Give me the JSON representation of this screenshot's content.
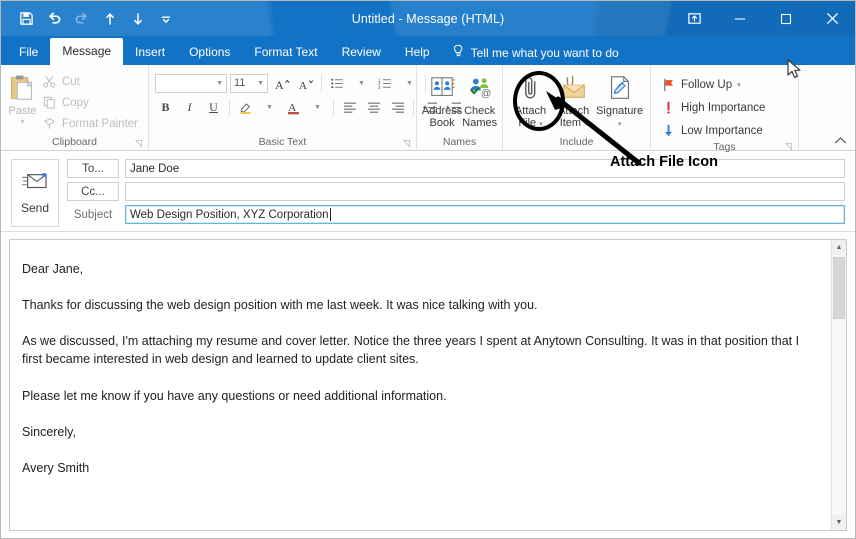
{
  "window": {
    "title": "Untitled  -  Message (HTML)",
    "quick_access": [
      {
        "name": "save",
        "label": "Save",
        "enabled": true
      },
      {
        "name": "undo",
        "label": "Undo",
        "enabled": true
      },
      {
        "name": "redo",
        "label": "Redo",
        "enabled": false
      },
      {
        "name": "previous-item",
        "label": "Previous Item",
        "enabled": true
      },
      {
        "name": "next-item",
        "label": "Next Item",
        "enabled": true
      },
      {
        "name": "customize-quick-access-toolbar",
        "label": "Customize Quick Access Toolbar",
        "enabled": true
      }
    ],
    "controls": [
      {
        "name": "ribbon-display-options",
        "label": "Ribbon Display Options"
      },
      {
        "name": "minimize",
        "label": "Minimize"
      },
      {
        "name": "maximize",
        "label": "Maximize"
      },
      {
        "name": "close",
        "label": "Close"
      }
    ]
  },
  "tabs": [
    {
      "label": "File",
      "active": false
    },
    {
      "label": "Message",
      "active": true
    },
    {
      "label": "Insert",
      "active": false
    },
    {
      "label": "Options",
      "active": false
    },
    {
      "label": "Format Text",
      "active": false
    },
    {
      "label": "Review",
      "active": false
    },
    {
      "label": "Help",
      "active": false
    }
  ],
  "tell_me": {
    "label": "Tell me what you want to do",
    "icon": "lightbulb-icon"
  },
  "ribbon": {
    "clipboard": {
      "group_label": "Clipboard",
      "paste": {
        "label": "Paste",
        "enabled": false
      },
      "items": [
        {
          "label": "Cut",
          "icon": "scissors-icon",
          "enabled": false
        },
        {
          "label": "Copy",
          "icon": "copy-icon",
          "enabled": false
        },
        {
          "label": "Format Painter",
          "icon": "format-painter-icon",
          "enabled": false
        }
      ]
    },
    "basic_text": {
      "group_label": "Basic Text",
      "font_name": "",
      "font_name_placeholder": "",
      "font_size": "11",
      "buttons_row1": [
        {
          "name": "grow-font",
          "label": "A"
        },
        {
          "name": "shrink-font",
          "label": "A"
        },
        {
          "name": "bullets",
          "label": "Bullets"
        },
        {
          "name": "numbering",
          "label": "Numbering"
        },
        {
          "name": "clear-formatting",
          "label": "Clear All Formatting"
        }
      ],
      "buttons_row2": [
        {
          "name": "bold",
          "label": "B"
        },
        {
          "name": "italic",
          "label": "I"
        },
        {
          "name": "underline",
          "label": "U"
        },
        {
          "name": "text-highlight-color",
          "label": "Text Highlight Color"
        },
        {
          "name": "font-color",
          "label": "A"
        },
        {
          "name": "align-left",
          "label": "Align Left"
        },
        {
          "name": "align-center",
          "label": "Center"
        },
        {
          "name": "align-right",
          "label": "Align Right"
        },
        {
          "name": "decrease-indent",
          "label": "Decrease Indent"
        },
        {
          "name": "increase-indent",
          "label": "Increase Indent"
        }
      ]
    },
    "names": {
      "group_label": "Names",
      "items": [
        {
          "label_line1": "Address",
          "label_line2": "Book",
          "icon": "address-book-icon"
        },
        {
          "label_line1": "Check",
          "label_line2": "Names",
          "icon": "check-names-icon"
        }
      ]
    },
    "include": {
      "group_label": "Include",
      "items": [
        {
          "label_line1": "Attach",
          "label_line2": "File",
          "icon": "paperclip-icon",
          "has_dropdown": true
        },
        {
          "label_line1": "Attach",
          "label_line2": "Item",
          "icon": "attach-item-icon",
          "has_dropdown": true
        },
        {
          "label_line1": "Signature",
          "label_line2": "",
          "icon": "signature-icon",
          "has_dropdown": true
        }
      ]
    },
    "tags": {
      "group_label": "Tags",
      "items": [
        {
          "label": "Follow Up",
          "icon": "flag-icon",
          "color": "#e8541f",
          "has_dropdown": true
        },
        {
          "label": "High Importance",
          "icon": "exclamation-icon",
          "color": "#d13438",
          "has_dropdown": false
        },
        {
          "label": "Low Importance",
          "icon": "down-arrow-icon",
          "color": "#2b7cd3",
          "has_dropdown": false
        }
      ]
    },
    "collapse_label": "Collapse the Ribbon"
  },
  "compose": {
    "send_button": "Send",
    "to_button": "To...",
    "to_value": "Jane Doe",
    "cc_button": "Cc...",
    "cc_value": "",
    "subject_label": "Subject",
    "subject_value": "Web Design Position, XYZ Corporation",
    "body_paragraphs": [
      "Dear Jane,",
      "Thanks for discussing the web design position with me last week. It was nice talking with you.",
      "As we discussed, I'm attaching my resume and cover letter. Notice the three years I spent at Anytown Consulting. It was in that position that I first became interested in web design and learned to update client sites.",
      "Please let me know if you have any questions or need additional information.",
      "Sincerely,",
      "Avery Smith"
    ]
  },
  "annotation": {
    "label": "Attach File Icon"
  },
  "colors": {
    "title_bar": "#1273c6",
    "accent": "#0f6cbd",
    "annotation": "#000000",
    "focus_border": "#6ab4d8"
  }
}
